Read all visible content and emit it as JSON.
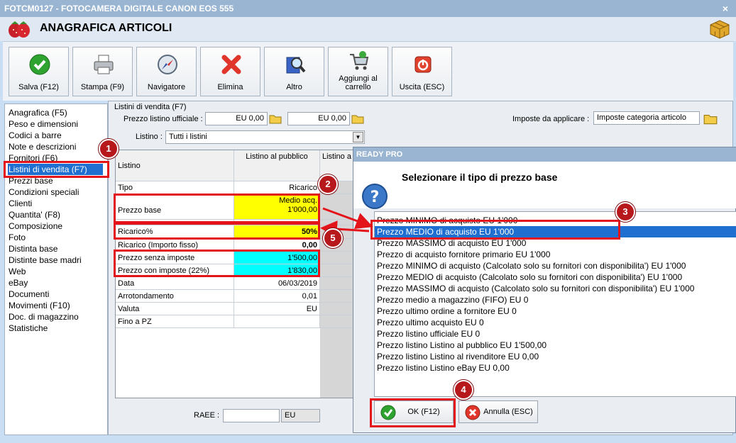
{
  "window": {
    "title": "FOTCM0127 - FOTOCAMERA DIGITALE CANON EOS 555",
    "close_label": "×"
  },
  "header": {
    "title": "ANAGRAFICA ARTICOLI"
  },
  "toolbar": {
    "buttons": [
      {
        "label": "Salva (F12)",
        "icon": "check-icon"
      },
      {
        "label": "Stampa (F9)",
        "icon": "printer-icon"
      },
      {
        "label": "Navigatore",
        "icon": "compass-icon"
      },
      {
        "label": "Elimina",
        "icon": "delete-x-icon"
      },
      {
        "label": "Altro",
        "icon": "magnifier-icon"
      },
      {
        "label": "Aggiungi al carrello",
        "icon": "cart-icon"
      },
      {
        "label": "Uscita (ESC)",
        "icon": "exit-icon"
      }
    ]
  },
  "sidebar": {
    "items": [
      "Anagrafica (F5)",
      "Peso e dimensioni",
      "Codici a barre",
      "Note e descrizioni",
      "Fornitori (F6)",
      "Listini di vendita (F7)",
      "Prezzi base",
      "Condizioni speciali",
      "Clienti",
      "Quantita' (F8)",
      "Composizione",
      "Foto",
      "Distinta base",
      "Distinte base madri",
      "Web",
      "eBay",
      "Documenti",
      "Movimenti (F10)",
      "Doc. di magazzino",
      "Statistiche"
    ],
    "selected_index": 5
  },
  "panel": {
    "title": "Listini di vendita (F7)",
    "prezzo_listino_label": "Prezzo listino ufficiale :",
    "prezzo_listino_value1": "EU 0,00",
    "prezzo_listino_value2": "EU 0,00",
    "imposte_label": "Imposte da applicare :",
    "imposte_value": "Imposte categoria articolo",
    "listino_label": "Listino :",
    "listino_value": "Tutti i listini",
    "raee_label": "RAEE :",
    "raee_value": "",
    "raee_unit": "EU"
  },
  "grid": {
    "header": {
      "c1": "Listino",
      "c2": "Listino al pubblico",
      "c3": "Listino a"
    },
    "rows": [
      {
        "c1": "Tipo",
        "c2": "Ricarico",
        "c2b": ""
      },
      {
        "c1": "Prezzo base",
        "c2": "Medio acq.",
        "c2b": "1'000,00"
      },
      {
        "c1": "Ricarico%",
        "c2": "50%",
        "c2b": ""
      },
      {
        "c1": "Ricarico (Importo fisso)",
        "c2": "0,00",
        "c2b": ""
      },
      {
        "c1": "Prezzo senza imposte",
        "c2": "1'500,00",
        "c2b": ""
      },
      {
        "c1": "Prezzo con imposte (22%)",
        "c2": "1'830,00",
        "c2b": ""
      },
      {
        "c1": "Data",
        "c2": "06/03/2019",
        "c2b": ""
      },
      {
        "c1": "Arrotondamento",
        "c2": "0,01",
        "c2b": ""
      },
      {
        "c1": "Valuta",
        "c2": "EU",
        "c2b": ""
      },
      {
        "c1": "Fino a PZ",
        "c2": "",
        "c2b": ""
      }
    ],
    "colors": {
      "yellow": "#ffff00",
      "cyan": "#00ffff"
    }
  },
  "dialog": {
    "title": "READY PRO",
    "message": "Selezionare il tipo di prezzo base",
    "options": [
      "Prezzo MINIMO di acquisto EU 1'000",
      "Prezzo MEDIO di acquisto EU 1'000",
      "Prezzo MASSIMO di acquisto EU 1'000",
      "Prezzo di acquisto fornitore primario EU 1'000",
      "Prezzo MINIMO di acquisto (Calcolato solo su fornitori con disponibilita') EU 1'000",
      "Prezzo MEDIO di acquisto (Calcolato solo su fornitori con disponibilita') EU 1'000",
      "Prezzo MASSIMO di acquisto (Calcolato solo su fornitori con disponibilita') EU 1'000",
      "Prezzo medio a magazzino (FIFO) EU 0",
      "Prezzo ultimo ordine a fornitore EU 0",
      "Prezzo ultimo acquisto EU 0",
      "Prezzo listino ufficiale EU 0",
      "Prezzo listino Listino al pubblico EU 1'500,00",
      "Prezzo listino Listino al rivenditore EU 0,00",
      "Prezzo listino Listino eBay EU 0,00"
    ],
    "selected_index": 1,
    "ok_label": "OK (F12)",
    "cancel_label": "Annulla (ESC)"
  },
  "annotations": {
    "badges": [
      "1",
      "2",
      "3",
      "4",
      "5"
    ],
    "color": "#e4141b"
  }
}
